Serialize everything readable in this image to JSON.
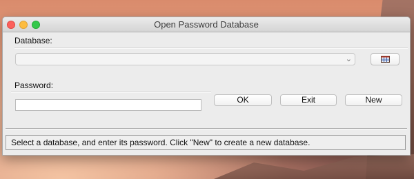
{
  "window": {
    "title": "Open Password Database"
  },
  "database": {
    "label": "Database:",
    "selected_value": "",
    "browse_icon": "database-table-icon"
  },
  "password": {
    "label": "Password:",
    "value": "",
    "placeholder": ""
  },
  "buttons": {
    "ok": "OK",
    "exit": "Exit",
    "new": "New"
  },
  "status": {
    "text": "Select a database, and enter its password. Click \"New\" to create a new database."
  },
  "colors": {
    "close": "#fc605c",
    "minimize": "#fdbc40",
    "maximize": "#34c84a"
  }
}
